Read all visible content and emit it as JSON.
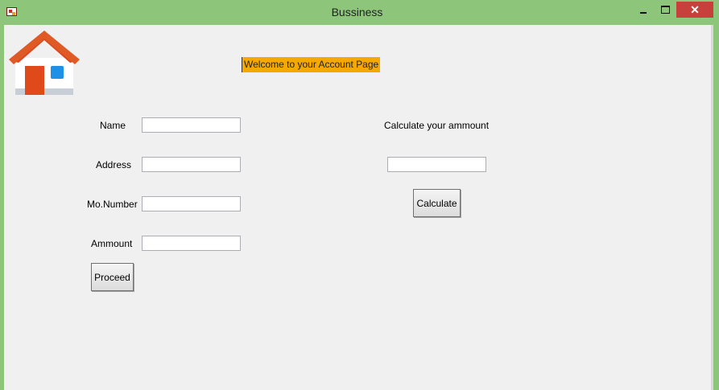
{
  "window": {
    "title": "Bussiness",
    "close_symbol": "✕"
  },
  "header": {
    "welcome_text": "Welcome to your Account Page"
  },
  "form": {
    "name_label": "Name",
    "address_label": "Address",
    "mobile_label": "Mo.Number",
    "amount_label": "Ammount",
    "name_value": "",
    "address_value": "",
    "mobile_value": "",
    "amount_value": "",
    "proceed_label": "Proceed"
  },
  "calc": {
    "heading": "Calculate your ammount",
    "value": "",
    "button_label": "Calculate"
  },
  "colors": {
    "titlebar": "#8dc57b",
    "welcome_bg": "#f5a800",
    "close_bg": "#c7403b",
    "client_bg": "#f0f0f0"
  },
  "icons": {
    "app": "app-icon",
    "home": "home-icon"
  }
}
